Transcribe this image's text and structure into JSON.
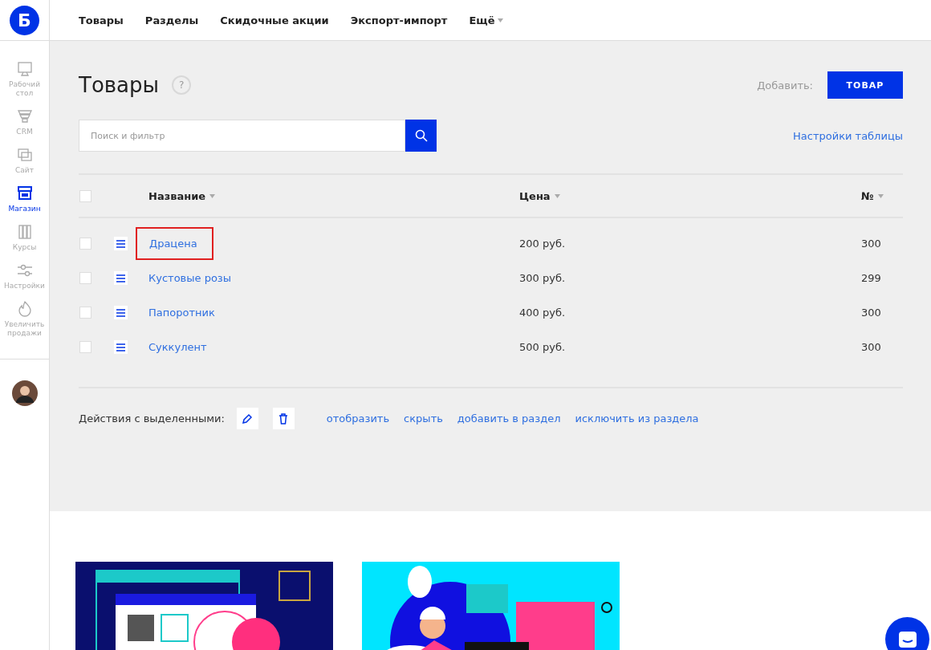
{
  "logo": {
    "letter": "Б"
  },
  "top_nav": [
    {
      "label": "Товары",
      "dropdown": false
    },
    {
      "label": "Разделы",
      "dropdown": false
    },
    {
      "label": "Скидочные акции",
      "dropdown": false
    },
    {
      "label": "Экспорт-импорт",
      "dropdown": false
    },
    {
      "label": "Ещё",
      "dropdown": true
    }
  ],
  "sidebar": {
    "items": [
      {
        "kind": "desktop",
        "label": "Рабочий стол",
        "selected": false
      },
      {
        "kind": "crm",
        "label": "CRM",
        "selected": false
      },
      {
        "kind": "site",
        "label": "Сайт",
        "selected": false
      },
      {
        "kind": "shop",
        "label": "Магазин",
        "selected": true
      },
      {
        "kind": "courses",
        "label": "Курсы",
        "selected": false
      },
      {
        "kind": "settings",
        "label": "Настройки",
        "selected": false
      },
      {
        "kind": "sales",
        "label": "Увеличить продажи",
        "selected": false
      }
    ]
  },
  "page": {
    "title": "Товары",
    "help": "?",
    "add_label": "Добавить:",
    "add_button": "ТОВАР"
  },
  "search": {
    "placeholder": "Поиск и фильтр"
  },
  "table_settings": "Настройки таблицы",
  "table": {
    "select_all_checked": false,
    "columns": [
      {
        "label": "Название",
        "sortable": true
      },
      {
        "label": "Цена",
        "sortable": true
      },
      {
        "label": "№",
        "sortable": true
      }
    ],
    "rows": [
      {
        "name": "Драцена",
        "price": "200 руб.",
        "number": "300",
        "checked": false,
        "highlighted": true
      },
      {
        "name": "Кустовые розы",
        "price": "300 руб.",
        "number": "299",
        "checked": false,
        "highlighted": false
      },
      {
        "name": "Папоротник",
        "price": "400 руб.",
        "number": "300",
        "checked": false,
        "highlighted": false
      },
      {
        "name": "Суккулент",
        "price": "500 руб.",
        "number": "300",
        "checked": false,
        "highlighted": false
      }
    ]
  },
  "bulk_actions": {
    "label": "Действия с выделенными:",
    "links": [
      "отобразить",
      "скрыть",
      "добавить в раздел",
      "исключить из раздела"
    ]
  },
  "promo_cards": [
    {
      "kind": "web"
    },
    {
      "kind": "support"
    }
  ]
}
